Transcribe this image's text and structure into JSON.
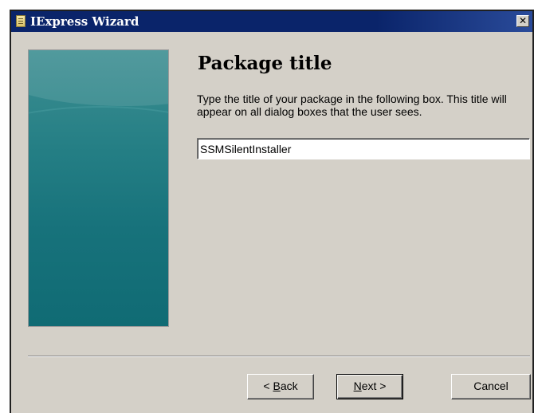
{
  "window": {
    "title": "IExpress Wizard",
    "close_glyph": "✕"
  },
  "page": {
    "heading": "Package title",
    "description": "Type the title of your package in the following  box.  This title will appear on all dialog boxes that the user sees.",
    "title_input": {
      "value": "SSMSilentInstaller",
      "placeholder": ""
    }
  },
  "buttons": {
    "back": {
      "prefix": "< ",
      "mnemonic": "B",
      "rest": "ack"
    },
    "next": {
      "mnemonic": "N",
      "rest": "ext >"
    },
    "cancel": "Cancel"
  },
  "icons": {
    "app": "package-app-icon",
    "close": "close-icon"
  },
  "colors": {
    "titlebar": "#0a246a",
    "dialog_face": "#d4d0c8",
    "side_panel": "#1f7a80"
  }
}
